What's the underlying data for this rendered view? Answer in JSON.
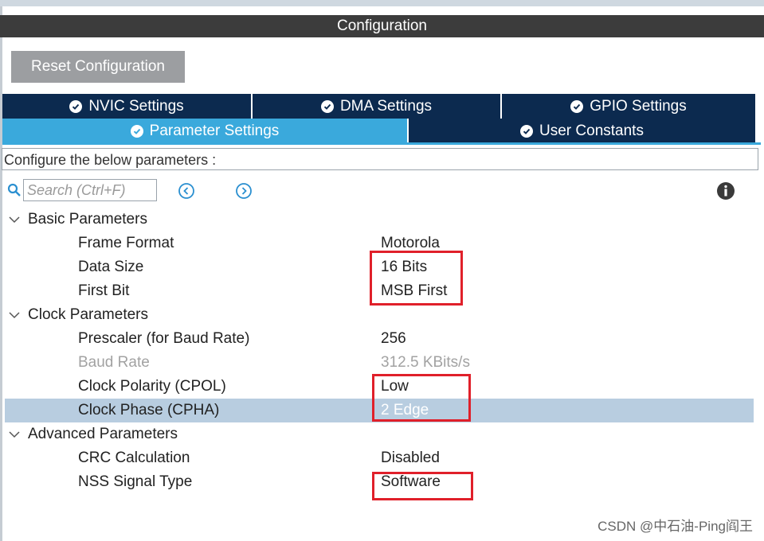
{
  "window": {
    "title": "Configuration"
  },
  "toolbar": {
    "reset_label": "Reset Configuration"
  },
  "tabs": {
    "row1": [
      {
        "label": "NVIC Settings"
      },
      {
        "label": "DMA Settings"
      },
      {
        "label": "GPIO Settings"
      }
    ],
    "row2": [
      {
        "label": "Parameter Settings",
        "active": true
      },
      {
        "label": "User Constants"
      }
    ]
  },
  "description": "Configure the below parameters :",
  "search": {
    "placeholder": "Search (Ctrl+F)"
  },
  "groups": [
    {
      "label": "Basic Parameters",
      "params": [
        {
          "name": "Frame Format",
          "value": "Motorola"
        },
        {
          "name": "Data Size",
          "value": "16 Bits"
        },
        {
          "name": "First Bit",
          "value": "MSB First"
        }
      ]
    },
    {
      "label": "Clock Parameters",
      "params": [
        {
          "name": "Prescaler (for Baud Rate)",
          "value": "256"
        },
        {
          "name": "Baud Rate",
          "value": "312.5 KBits/s",
          "disabled": true
        },
        {
          "name": "Clock Polarity (CPOL)",
          "value": "Low"
        },
        {
          "name": "Clock Phase (CPHA)",
          "value": "2 Edge",
          "selected": true
        }
      ]
    },
    {
      "label": "Advanced Parameters",
      "params": [
        {
          "name": "CRC Calculation",
          "value": "Disabled"
        },
        {
          "name": "NSS Signal Type",
          "value": "Software"
        }
      ]
    }
  ],
  "watermark": "CSDN @中石油-Ping阎王",
  "colors": {
    "title_bar": "#3c3c3c",
    "tab_dark": "#0c2a4f",
    "tab_active": "#3aa9dc",
    "selected_row": "#b8cde0",
    "highlight": "#e0202a"
  }
}
